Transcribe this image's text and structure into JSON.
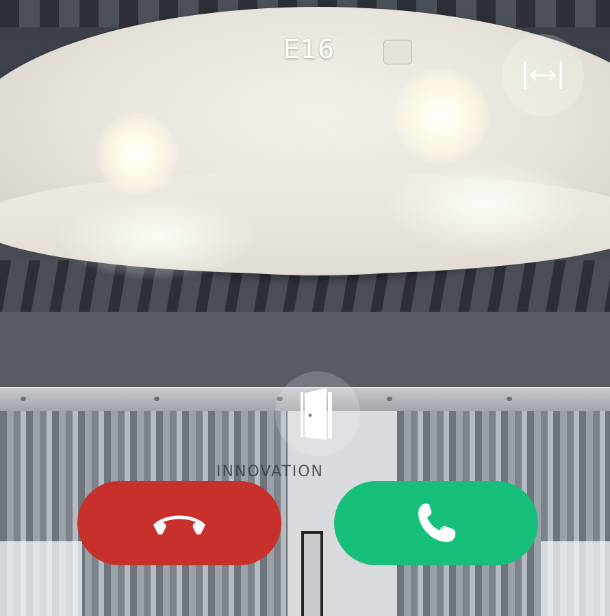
{
  "call": {
    "title": "E16"
  },
  "scene": {
    "wall_text": "INNOVATION"
  },
  "controls": {
    "resize_icon": "resize-horizontal-icon",
    "door_icon": "door-icon",
    "decline_icon": "phone-hangup-icon",
    "accept_icon": "phone-icon"
  },
  "colors": {
    "decline": "#c7302b",
    "accept": "#17c07a",
    "overlay_circle": "rgba(255,255,255,0.22)",
    "title": "#ffffff"
  }
}
